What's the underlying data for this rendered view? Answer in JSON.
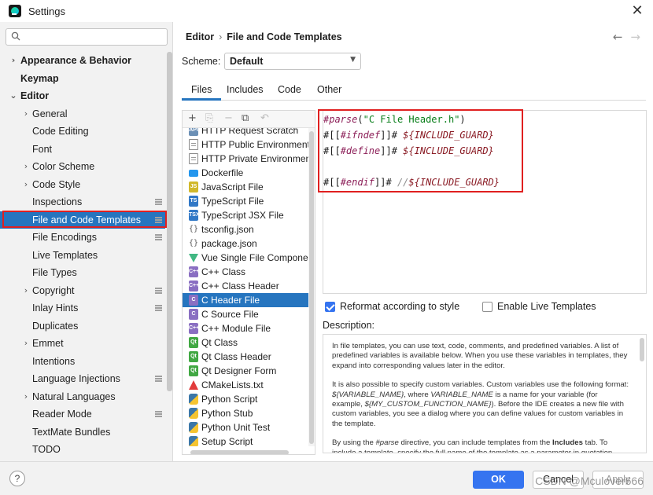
{
  "window": {
    "title": "Settings",
    "close_label": "✕"
  },
  "sidebar": {
    "search_placeholder": "Q▾",
    "items": [
      {
        "label": "Appearance & Behavior",
        "arrow": "›",
        "indent": 0,
        "bold": true,
        "gear": false,
        "selected": false
      },
      {
        "label": "Keymap",
        "arrow": "",
        "indent": 0,
        "bold": true,
        "gear": false,
        "selected": false
      },
      {
        "label": "Editor",
        "arrow": "⌄",
        "indent": 0,
        "bold": true,
        "gear": false,
        "selected": false
      },
      {
        "label": "General",
        "arrow": "›",
        "indent": 1,
        "bold": false,
        "gear": false,
        "selected": false
      },
      {
        "label": "Code Editing",
        "arrow": "",
        "indent": 1,
        "bold": false,
        "gear": false,
        "selected": false
      },
      {
        "label": "Font",
        "arrow": "",
        "indent": 1,
        "bold": false,
        "gear": false,
        "selected": false
      },
      {
        "label": "Color Scheme",
        "arrow": "›",
        "indent": 1,
        "bold": false,
        "gear": false,
        "selected": false
      },
      {
        "label": "Code Style",
        "arrow": "›",
        "indent": 1,
        "bold": false,
        "gear": false,
        "selected": false
      },
      {
        "label": "Inspections",
        "arrow": "",
        "indent": 1,
        "bold": false,
        "gear": true,
        "selected": false
      },
      {
        "label": "File and Code Templates",
        "arrow": "",
        "indent": 1,
        "bold": false,
        "gear": true,
        "selected": true
      },
      {
        "label": "File Encodings",
        "arrow": "",
        "indent": 1,
        "bold": false,
        "gear": true,
        "selected": false
      },
      {
        "label": "Live Templates",
        "arrow": "",
        "indent": 1,
        "bold": false,
        "gear": false,
        "selected": false
      },
      {
        "label": "File Types",
        "arrow": "",
        "indent": 1,
        "bold": false,
        "gear": false,
        "selected": false
      },
      {
        "label": "Copyright",
        "arrow": "›",
        "indent": 1,
        "bold": false,
        "gear": true,
        "selected": false
      },
      {
        "label": "Inlay Hints",
        "arrow": "",
        "indent": 1,
        "bold": false,
        "gear": true,
        "selected": false
      },
      {
        "label": "Duplicates",
        "arrow": "",
        "indent": 1,
        "bold": false,
        "gear": false,
        "selected": false
      },
      {
        "label": "Emmet",
        "arrow": "›",
        "indent": 1,
        "bold": false,
        "gear": false,
        "selected": false
      },
      {
        "label": "Intentions",
        "arrow": "",
        "indent": 1,
        "bold": false,
        "gear": false,
        "selected": false
      },
      {
        "label": "Language Injections",
        "arrow": "",
        "indent": 1,
        "bold": false,
        "gear": true,
        "selected": false
      },
      {
        "label": "Natural Languages",
        "arrow": "›",
        "indent": 1,
        "bold": false,
        "gear": false,
        "selected": false
      },
      {
        "label": "Reader Mode",
        "arrow": "",
        "indent": 1,
        "bold": false,
        "gear": true,
        "selected": false
      },
      {
        "label": "TextMate Bundles",
        "arrow": "",
        "indent": 1,
        "bold": false,
        "gear": false,
        "selected": false
      },
      {
        "label": "TODO",
        "arrow": "",
        "indent": 1,
        "bold": false,
        "gear": false,
        "selected": false
      }
    ]
  },
  "header": {
    "crumb_parent": "Editor",
    "crumb_separator": "›",
    "crumb_current": "File and Code Templates",
    "back_arrow": "←",
    "forward_arrow": "→"
  },
  "scheme": {
    "label": "Scheme:",
    "value": "Default"
  },
  "tabs": [
    {
      "label": "Files",
      "active": true
    },
    {
      "label": "Includes",
      "active": false
    },
    {
      "label": "Code",
      "active": false
    },
    {
      "label": "Other",
      "active": false
    }
  ],
  "toolbar": {
    "add": "+",
    "add_child": "⎘",
    "remove": "−",
    "copy": "⧉",
    "reset": "↶"
  },
  "templates": [
    {
      "label": "HTTP Request Scratch",
      "icon": "api",
      "icon_text": "API",
      "color": "#6b8fb5",
      "selected": false
    },
    {
      "label": "HTTP Public Environment File",
      "icon": "doc",
      "icon_text": "",
      "color": "",
      "selected": false
    },
    {
      "label": "HTTP Private Environment File",
      "icon": "doc",
      "icon_text": "",
      "color": "",
      "selected": false
    },
    {
      "label": "Dockerfile",
      "icon": "whale",
      "icon_text": "",
      "color": "#2496ed",
      "selected": false
    },
    {
      "label": "JavaScript File",
      "icon": "badge",
      "icon_text": "JS",
      "color": "#d1b82a",
      "selected": false
    },
    {
      "label": "TypeScript File",
      "icon": "badge",
      "icon_text": "TS",
      "color": "#3178c6",
      "selected": false
    },
    {
      "label": "TypeScript JSX File",
      "icon": "badge",
      "icon_text": "TSX",
      "color": "#3178c6",
      "selected": false
    },
    {
      "label": "tsconfig.json",
      "icon": "json",
      "icon_text": "{}",
      "color": "",
      "selected": false
    },
    {
      "label": "package.json",
      "icon": "json",
      "icon_text": "{}",
      "color": "",
      "selected": false
    },
    {
      "label": "Vue Single File Component",
      "icon": "tri",
      "icon_text": "",
      "color": "#41b883",
      "selected": false
    },
    {
      "label": "C++ Class",
      "icon": "badge",
      "icon_text": "C++",
      "color": "#8a6fc2",
      "selected": false
    },
    {
      "label": "C++ Class Header",
      "icon": "badge",
      "icon_text": "C++",
      "color": "#8a6fc2",
      "selected": false
    },
    {
      "label": "C Header File",
      "icon": "badge",
      "icon_text": "C",
      "color": "#8a6fc2",
      "selected": true
    },
    {
      "label": "C Source File",
      "icon": "badge",
      "icon_text": "C",
      "color": "#8a6fc2",
      "selected": false
    },
    {
      "label": "C++ Module File",
      "icon": "badge",
      "icon_text": "C++",
      "color": "#8a6fc2",
      "selected": false
    },
    {
      "label": "Qt Class",
      "icon": "badge",
      "icon_text": "Qt",
      "color": "#41a843",
      "selected": false
    },
    {
      "label": "Qt Class Header",
      "icon": "badge",
      "icon_text": "Qt",
      "color": "#41a843",
      "selected": false
    },
    {
      "label": "Qt Designer Form",
      "icon": "badge",
      "icon_text": "Qt",
      "color": "#41a843",
      "selected": false
    },
    {
      "label": "CMakeLists.txt",
      "icon": "cmake",
      "icon_text": "",
      "color": "#e23c3c",
      "selected": false
    },
    {
      "label": "Python Script",
      "icon": "py",
      "icon_text": "",
      "color": "#3b77a8",
      "selected": false
    },
    {
      "label": "Python Stub",
      "icon": "py",
      "icon_text": "",
      "color": "#3b77a8",
      "selected": false
    },
    {
      "label": "Python Unit Test",
      "icon": "py",
      "icon_text": "",
      "color": "#3b77a8",
      "selected": false
    },
    {
      "label": "Setup Script",
      "icon": "py",
      "icon_text": "",
      "color": "#3b77a8",
      "selected": false
    }
  ],
  "code": {
    "line1": [
      {
        "t": "#parse",
        "c": "kw"
      },
      {
        "t": "(",
        "c": ""
      },
      {
        "t": "\"C File Header.h\"",
        "c": "str"
      },
      {
        "t": ")",
        "c": ""
      }
    ],
    "line2": [
      {
        "t": "#[[",
        "c": ""
      },
      {
        "t": "#ifndef",
        "c": "kw"
      },
      {
        "t": "]]# ",
        "c": ""
      },
      {
        "t": "${INCLUDE_GUARD}",
        "c": "var"
      }
    ],
    "line3": [
      {
        "t": "#[[",
        "c": ""
      },
      {
        "t": "#define",
        "c": "kw"
      },
      {
        "t": "]]# ",
        "c": ""
      },
      {
        "t": "${INCLUDE_GUARD}",
        "c": "var"
      }
    ],
    "line4": [
      {
        "t": "#[[",
        "c": ""
      },
      {
        "t": "#endif",
        "c": "kw"
      },
      {
        "t": "]]# ",
        "c": ""
      },
      {
        "t": "//",
        "c": "cmt"
      },
      {
        "t": "${INCLUDE_GUARD}",
        "c": "var"
      }
    ]
  },
  "options": {
    "reformat_label": "Reformat according to style",
    "reformat_checked": true,
    "live_templates_label": "Enable Live Templates",
    "live_templates_checked": false
  },
  "description": {
    "label": "Description:",
    "para1": "In file templates, you can use text, code, comments, and predefined variables. A list of predefined variables is available below. When you use these variables in templates, they expand into corresponding values later in the editor.",
    "para2_a": "It is also possible to specify custom variables. Custom variables use the following format: ",
    "para2_var1": "${VARIABLE_NAME}",
    "para2_b": ", where ",
    "para2_var2": "VARIABLE_NAME",
    "para2_c": " is a name for your variable (for example, ",
    "para2_var3": "${MY_CUSTOM_FUNCTION_NAME}",
    "para2_d": "). Before the IDE creates a new file with custom variables, you see a dialog where you can define values for custom variables in the template.",
    "para3_a": "By using the ",
    "para3_parse": "#parse",
    "para3_b": " directive, you can include templates from the ",
    "para3_includes": "Includes",
    "para3_c": " tab. To include a template, specify the full name of the template as a parameter in quotation marks."
  },
  "footer": {
    "help_label": "?",
    "ok_label": "OK",
    "cancel_label": "Cancel",
    "apply_label": "Apply",
    "watermark": "CSDN @Mculover666"
  },
  "colors": {
    "accent": "#2675bf",
    "primary_button": "#3574f0",
    "highlight_outline": "#e02020"
  }
}
